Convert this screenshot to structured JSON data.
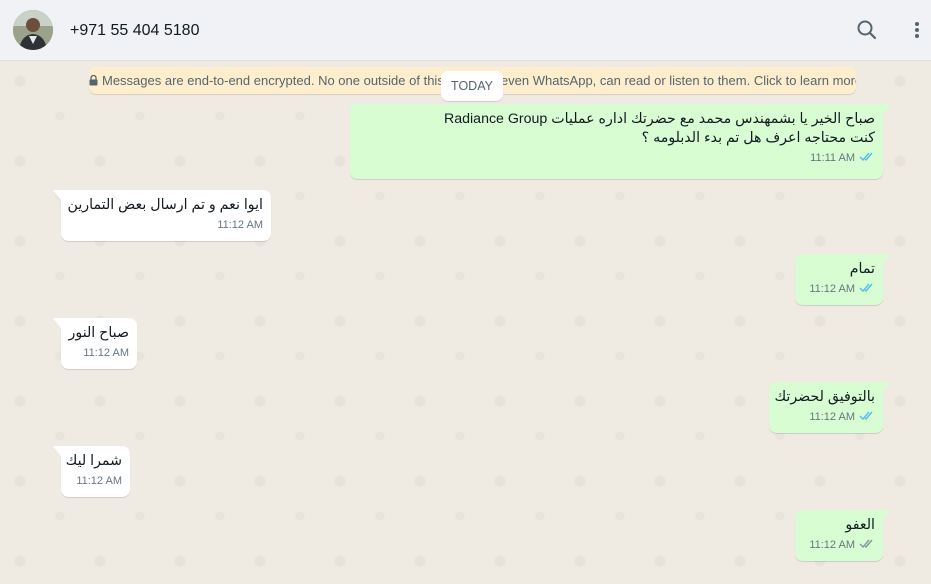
{
  "header": {
    "contact_name": "+971 55 404 5180",
    "search_icon": "search-icon",
    "menu_icon": "more-vertical-icon"
  },
  "chat": {
    "encryption_notice": "Messages are end-to-end encrypted. No one outside of this chat, not even WhatsApp, can read or listen to them. Click to learn more",
    "date_label": "TODAY",
    "messages": [
      {
        "direction": "out",
        "lines": [
          "صباح الخير يا بشمهندس محمد مع حضرتك اداره عمليات Radiance Group",
          "كنت محتاجه اعرف هل تم بدء الدبلومه ؟"
        ],
        "time": "11:11 AM",
        "status": "read"
      },
      {
        "direction": "in",
        "lines": [
          "ايوا نعم و تم ارسال بعض التمارين"
        ],
        "time": "11:12 AM"
      },
      {
        "direction": "out",
        "lines": [
          "تمام"
        ],
        "time": "11:12 AM",
        "status": "read"
      },
      {
        "direction": "in",
        "lines": [
          "صباح النور"
        ],
        "time": "11:12 AM"
      },
      {
        "direction": "out",
        "lines": [
          "بالتوفيق لحضرتك"
        ],
        "time": "11:12 AM",
        "status": "read"
      },
      {
        "direction": "in",
        "lines": [
          "شمرا ليك"
        ],
        "time": "11:12 AM"
      },
      {
        "direction": "out",
        "lines": [
          "العفو"
        ],
        "time": "11:12 AM",
        "status": "delivered"
      }
    ]
  },
  "colors": {
    "outgoing_bubble": "#d9fdd3",
    "incoming_bubble": "#ffffff",
    "read_ticks": "#53bdeb",
    "delivered_ticks": "#8696a0",
    "notice_bg": "#ffeecd"
  }
}
